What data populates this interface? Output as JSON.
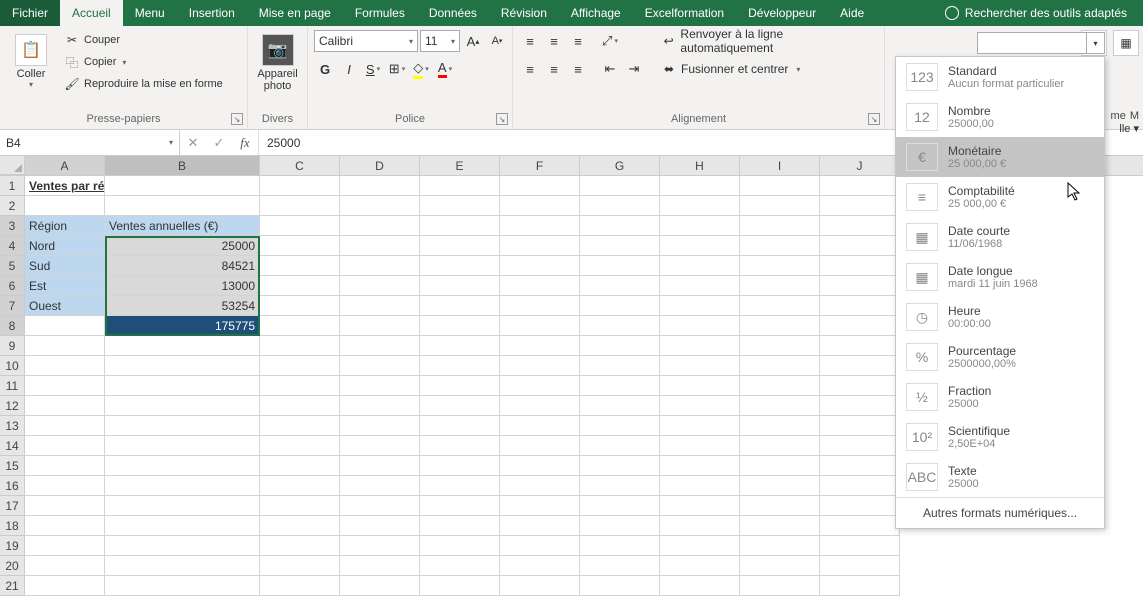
{
  "menu": {
    "file": "Fichier",
    "home": "Accueil",
    "tabs": [
      "Menu",
      "Insertion",
      "Mise en page",
      "Formules",
      "Données",
      "Révision",
      "Affichage",
      "Excelformation",
      "Développeur",
      "Aide"
    ],
    "search": "Rechercher des outils adaptés"
  },
  "ribbon": {
    "clipboard": {
      "paste": "Coller",
      "cut": "Couper",
      "copy": "Copier",
      "format_painter": "Reproduire la mise en forme",
      "label": "Presse-papiers"
    },
    "camera": {
      "btn": "Appareil photo",
      "label": "Divers"
    },
    "font": {
      "name": "Calibri",
      "size": "11",
      "label": "Police"
    },
    "align": {
      "wrap": "Renvoyer à la ligne automatiquement",
      "merge": "Fusionner et centrer",
      "label": "Alignement"
    },
    "far": {
      "me": "me",
      "lle": "lle ▾",
      "m": "M"
    }
  },
  "formula_bar": {
    "cell_ref": "B4",
    "value": "25000"
  },
  "columns": [
    "A",
    "B",
    "C",
    "D",
    "E",
    "F",
    "G",
    "H",
    "I",
    "J"
  ],
  "sheet": {
    "title": "Ventes par région :",
    "hdr_region": "Région",
    "hdr_ventes": "Ventes annuelles (€)",
    "rows": [
      {
        "region": "Nord",
        "val": "25000"
      },
      {
        "region": "Sud",
        "val": "84521"
      },
      {
        "region": "Est",
        "val": "13000"
      },
      {
        "region": "Ouest",
        "val": "53254"
      }
    ],
    "total": "175775"
  },
  "numfmt": {
    "items": [
      {
        "icon": "123",
        "t": "Standard",
        "s": "Aucun format particulier"
      },
      {
        "icon": "12",
        "t": "Nombre",
        "s": "25000,00"
      },
      {
        "icon": "€",
        "t": "Monétaire",
        "s": "25 000,00 €"
      },
      {
        "icon": "≡",
        "t": "Comptabilité",
        "s": "25 000,00 €"
      },
      {
        "icon": "▦",
        "t": "Date courte",
        "s": "11/06/1968"
      },
      {
        "icon": "▦",
        "t": "Date longue",
        "s": "mardi 11 juin 1968"
      },
      {
        "icon": "◷",
        "t": "Heure",
        "s": "00:00:00"
      },
      {
        "icon": "%",
        "t": "Pourcentage",
        "s": "2500000,00%"
      },
      {
        "icon": "½",
        "t": "Fraction",
        "s": "25000"
      },
      {
        "icon": "10²",
        "t": "Scientifique",
        "s": "2,50E+04"
      },
      {
        "icon": "ABC",
        "t": "Texte",
        "s": "25000"
      }
    ],
    "footer": "Autres formats numériques..."
  }
}
